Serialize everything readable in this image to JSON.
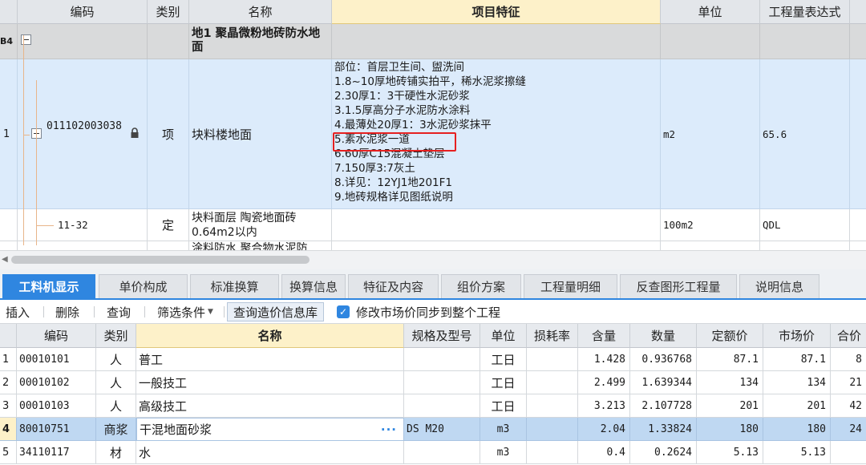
{
  "top_headers": {
    "code": "编码",
    "type": "类别",
    "name": "名称",
    "features": "项目特征",
    "unit": "单位",
    "qty_expr": "工程量表达式"
  },
  "group_row": {
    "index": "B4",
    "name": "地1 聚晶微粉地砖防水地面"
  },
  "item_row": {
    "index": "1",
    "code": "011102003038",
    "type": "项",
    "name": "块料楼地面",
    "unit": "m2",
    "qty_expr": "65.6",
    "features": [
      "部位：首层卫生间、盥洗间",
      "1.8~10厚地砖铺实拍平，稀水泥浆擦缝",
      "2.30厚1：3干硬性水泥砂浆",
      "3.1.5厚高分子水泥防水涂料",
      "4.最薄处20厚1：3水泥砂浆抹平",
      "5.素水泥浆一道",
      "6.60厚C15混凝土垫层",
      "7.150厚3:7灰土",
      "8.详见：12YJ1地201F1",
      "9.地砖规格详见图纸说明"
    ]
  },
  "quota_row": {
    "code": "11-32",
    "type": "定",
    "name": "块料面层 陶瓷地面砖 0.64m2以内",
    "unit": "100m2",
    "qty_expr": "QDL"
  },
  "partial_row": {
    "name": "涂料防水 聚合物水泥防"
  },
  "tabs": [
    "工料机显示",
    "单价构成",
    "标准换算",
    "换算信息",
    "特征及内容",
    "组价方案",
    "工程量明细",
    "反查图形工程量",
    "说明信息"
  ],
  "toolbar": {
    "insert": "插入",
    "delete": "删除",
    "query": "查询",
    "filter": "筛选条件",
    "price_db": "查询造价信息库",
    "sync_label": "修改市场价同步到整个工程"
  },
  "bottom_headers": {
    "code": "编码",
    "type": "类别",
    "name": "名称",
    "spec": "规格及型号",
    "unit": "单位",
    "loss": "损耗率",
    "content": "含量",
    "quantity": "数量",
    "quota_price": "定额价",
    "market_price": "市场价",
    "total": "合价"
  },
  "bottom_rows": [
    {
      "index": "1",
      "code": "00010101",
      "type": "人",
      "name": "普工",
      "spec": "",
      "unit": "工日",
      "loss": "",
      "content": "1.428",
      "quantity": "0.936768",
      "quota_price": "87.1",
      "market_price": "87.1",
      "total": "8"
    },
    {
      "index": "2",
      "code": "00010102",
      "type": "人",
      "name": "一般技工",
      "spec": "",
      "unit": "工日",
      "loss": "",
      "content": "2.499",
      "quantity": "1.639344",
      "quota_price": "134",
      "market_price": "134",
      "total": "21"
    },
    {
      "index": "3",
      "code": "00010103",
      "type": "人",
      "name": "高级技工",
      "spec": "",
      "unit": "工日",
      "loss": "",
      "content": "3.213",
      "quantity": "2.107728",
      "quota_price": "201",
      "market_price": "201",
      "total": "42"
    },
    {
      "index": "4",
      "code": "80010751",
      "type": "商浆",
      "name": "干混地面砂浆",
      "spec": "DS M20",
      "unit": "m3",
      "loss": "",
      "content": "2.04",
      "quantity": "1.33824",
      "quota_price": "180",
      "market_price": "180",
      "total": "24"
    },
    {
      "index": "5",
      "code": "34110117",
      "type": "材",
      "name": "水",
      "spec": "",
      "unit": "m3",
      "loss": "",
      "content": "0.4",
      "quantity": "0.2624",
      "quota_price": "5.13",
      "market_price": "5.13",
      "total": ""
    }
  ],
  "colors": {
    "accent": "#2f86e0",
    "selected_row": "#dcebfb",
    "highlight_box": "#e62020",
    "active_header": "#fdf1c9"
  }
}
